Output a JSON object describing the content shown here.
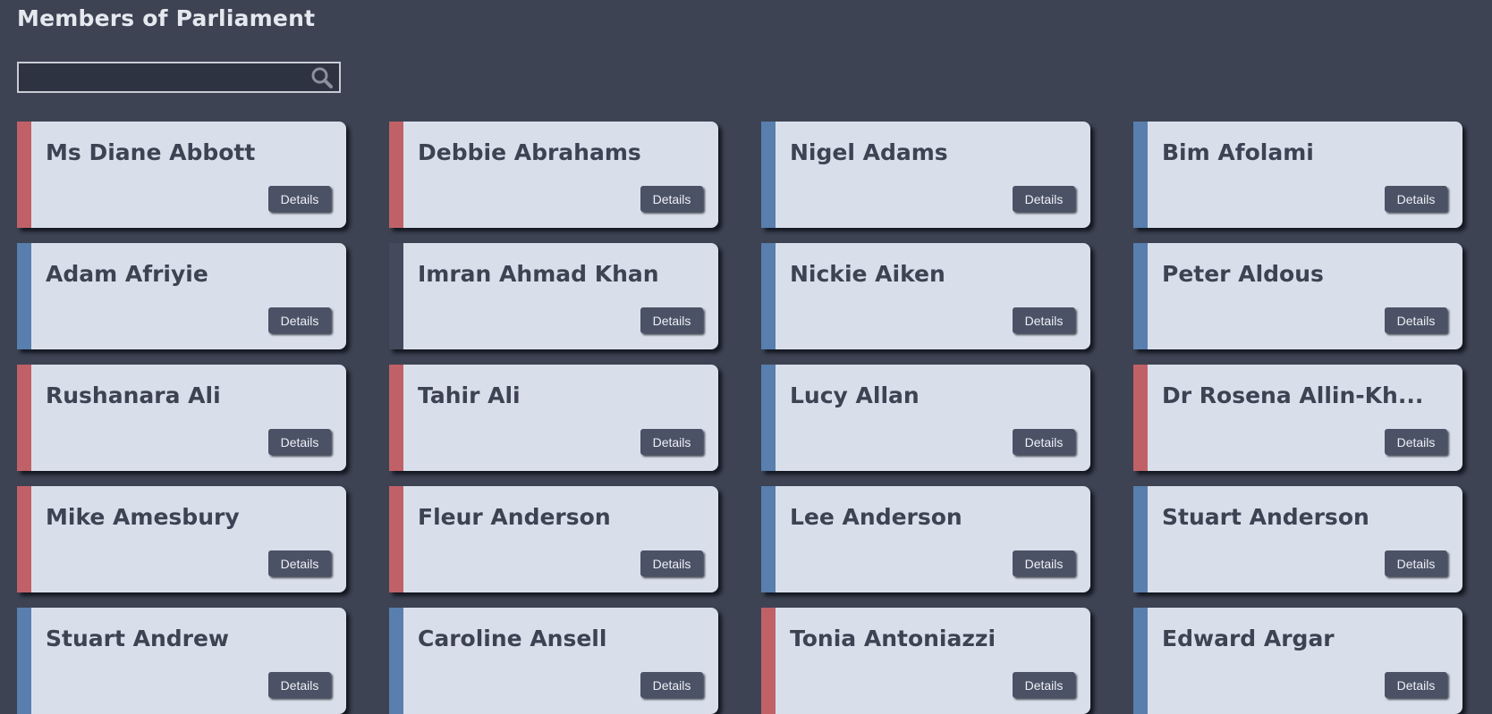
{
  "page": {
    "title": "Members of Parliament"
  },
  "search": {
    "value": "",
    "placeholder": "",
    "icon": "search-icon"
  },
  "colors": {
    "background": "#3d4353",
    "card": "#d9dfea",
    "red_party": "#c06168",
    "blue_party": "#587fae",
    "dark_party": "#434a5c",
    "button": "#4b5266"
  },
  "members": [
    {
      "name": "Ms Diane Abbott",
      "party_color": "#c06168",
      "button_label": "Details"
    },
    {
      "name": "Debbie Abrahams",
      "party_color": "#c06168",
      "button_label": "Details"
    },
    {
      "name": "Nigel Adams",
      "party_color": "#587fae",
      "button_label": "Details"
    },
    {
      "name": "Bim Afolami",
      "party_color": "#587fae",
      "button_label": "Details"
    },
    {
      "name": "Adam Afriyie",
      "party_color": "#587fae",
      "button_label": "Details"
    },
    {
      "name": "Imran Ahmad Khan",
      "party_color": "#434a5c",
      "button_label": "Details"
    },
    {
      "name": "Nickie Aiken",
      "party_color": "#587fae",
      "button_label": "Details"
    },
    {
      "name": "Peter Aldous",
      "party_color": "#587fae",
      "button_label": "Details"
    },
    {
      "name": "Rushanara Ali",
      "party_color": "#c06168",
      "button_label": "Details"
    },
    {
      "name": "Tahir Ali",
      "party_color": "#c06168",
      "button_label": "Details"
    },
    {
      "name": "Lucy Allan",
      "party_color": "#587fae",
      "button_label": "Details"
    },
    {
      "name": "Dr Rosena Allin-Kh...",
      "party_color": "#c06168",
      "button_label": "Details"
    },
    {
      "name": "Mike Amesbury",
      "party_color": "#c06168",
      "button_label": "Details"
    },
    {
      "name": "Fleur Anderson",
      "party_color": "#c06168",
      "button_label": "Details"
    },
    {
      "name": "Lee Anderson",
      "party_color": "#587fae",
      "button_label": "Details"
    },
    {
      "name": "Stuart Anderson",
      "party_color": "#587fae",
      "button_label": "Details"
    },
    {
      "name": "Stuart Andrew",
      "party_color": "#587fae",
      "button_label": "Details"
    },
    {
      "name": "Caroline Ansell",
      "party_color": "#587fae",
      "button_label": "Details"
    },
    {
      "name": "Tonia Antoniazzi",
      "party_color": "#c06168",
      "button_label": "Details"
    },
    {
      "name": "Edward Argar",
      "party_color": "#587fae",
      "button_label": "Details"
    }
  ]
}
